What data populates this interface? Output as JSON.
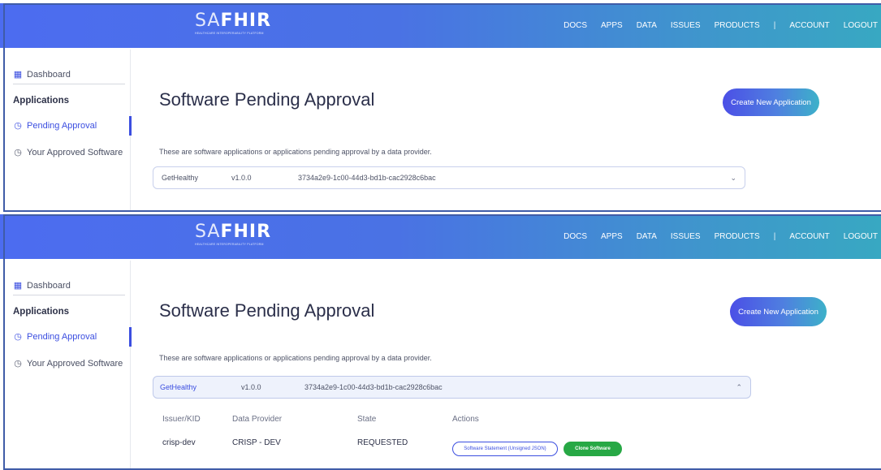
{
  "logo": {
    "thin": "SA",
    "bold": "FHIR",
    "tagline": "HEALTHCARE INTEROPERABILITY PLATFORM"
  },
  "nav": [
    "DOCS",
    "APPS",
    "DATA",
    "ISSUES",
    "PRODUCTS",
    "|",
    "ACCOUNT",
    "LOGOUT"
  ],
  "sidebar": {
    "dashboard": {
      "icon": "grid-icon",
      "label": "Dashboard"
    },
    "section": "Applications",
    "pending": {
      "icon": "clock-icon",
      "label": "Pending Approval"
    },
    "approved": {
      "icon": "clock-icon",
      "label": "Your Approved Software"
    }
  },
  "page": {
    "title": "Software Pending Approval",
    "create_button": "Create New Application",
    "description": "These are software applications or applications pending approval by a data provider."
  },
  "applications": [
    {
      "name": "GetHealthy",
      "version": "v1.0.0",
      "id": "3734a2e9-1c00-44d3-bd1b-cac2928c6bac"
    }
  ],
  "details": {
    "headers": [
      "Issuer/KID",
      "Data Provider",
      "State",
      "Actions"
    ],
    "row": {
      "issuer": "crisp-dev",
      "provider": "CRISP - DEV",
      "state": "REQUESTED",
      "action_statement": "Software Statement (Unsigned JSON)",
      "action_clone": "Clone Software"
    }
  },
  "icons": {
    "collapsed": "chevron-down-icon",
    "expanded": "chevron-up-icon"
  },
  "colors": {
    "accent": "#3b4ee0",
    "header_start": "#4c6cf0",
    "header_end": "#38a8c2",
    "success": "#27a845"
  }
}
